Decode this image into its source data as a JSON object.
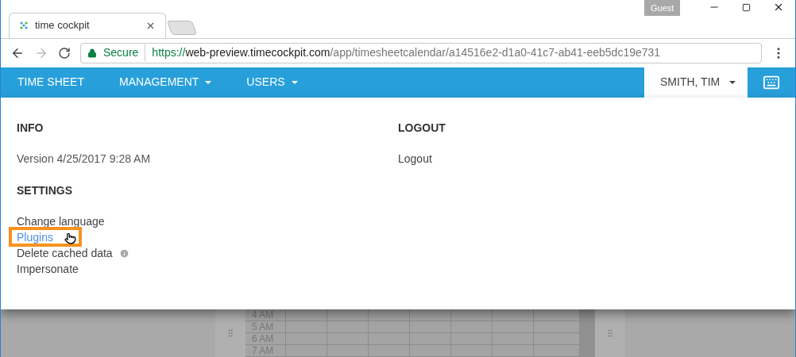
{
  "browser": {
    "profile": "Guest",
    "tab": {
      "title": "time cockpit"
    },
    "address": {
      "secure_label": "Secure",
      "scheme": "https://",
      "host": "web-preview.timecockpit.com",
      "path": "/app/timesheetcalendar/a14516e2-d1a0-41c7-ab41-eeb5dc19e731"
    }
  },
  "nav": {
    "items": [
      {
        "label": "TIME SHEET",
        "dropdown": false
      },
      {
        "label": "MANAGEMENT",
        "dropdown": true
      },
      {
        "label": "USERS",
        "dropdown": true
      }
    ],
    "user": {
      "label": "SMITH, TIM",
      "selected": true
    }
  },
  "menu": {
    "columns": [
      {
        "sections": [
          {
            "heading": "INFO",
            "items": [
              {
                "label": "Version 4/25/2017 9:28 AM",
                "kind": "text",
                "hovered": false,
                "info": false
              }
            ]
          },
          {
            "heading": "SETTINGS",
            "items": [
              {
                "label": "Change language",
                "kind": "link",
                "hovered": false,
                "info": false
              },
              {
                "label": "Plugins",
                "kind": "link",
                "hovered": true,
                "info": false
              },
              {
                "label": "Delete cached data",
                "kind": "link",
                "hovered": false,
                "info": true
              },
              {
                "label": "Impersonate",
                "kind": "link",
                "hovered": false,
                "info": false
              }
            ]
          }
        ]
      },
      {
        "sections": [
          {
            "heading": "LOGOUT",
            "items": [
              {
                "label": "Logout",
                "kind": "link",
                "hovered": false,
                "info": false
              }
            ]
          }
        ]
      }
    ]
  },
  "background": {
    "hours": [
      "4 AM",
      "5 AM",
      "6 AM",
      "7 AM"
    ]
  }
}
